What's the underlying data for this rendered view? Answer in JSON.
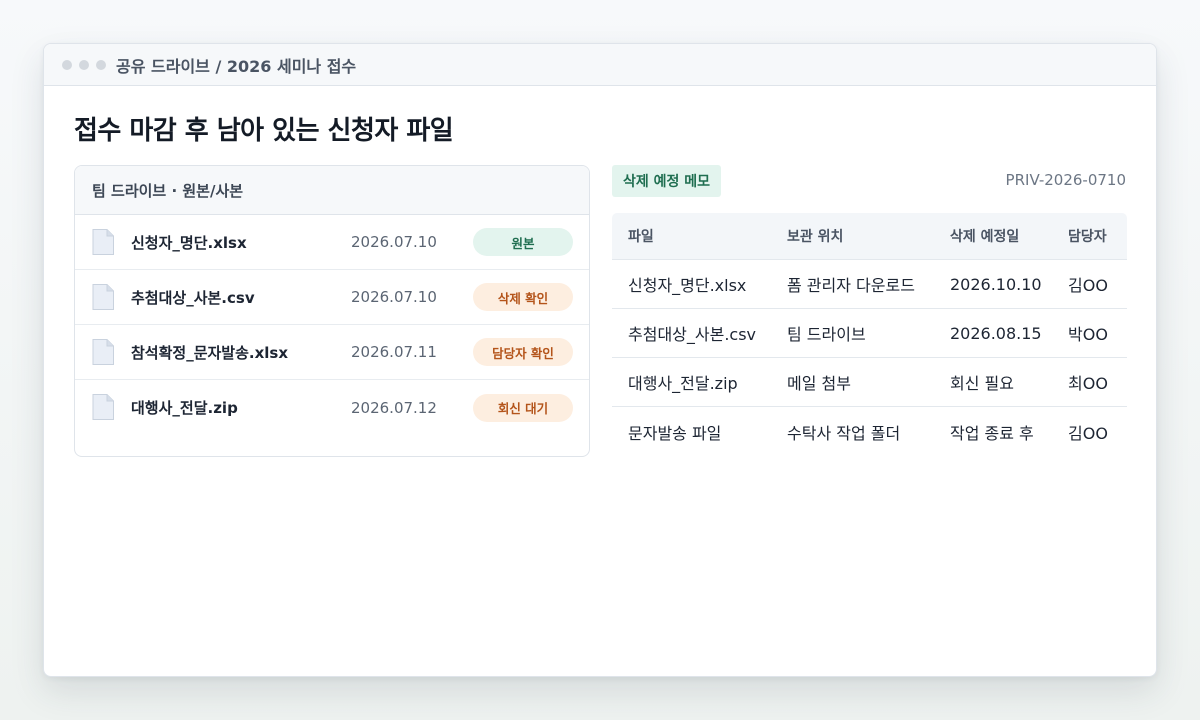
{
  "window": {
    "breadcrumb": "공유 드라이브 / 2026 세미나 접수"
  },
  "page": {
    "title": "접수 마감 후 남아 있는 신청자 파일"
  },
  "drive_panel": {
    "header": "팀 드라이브 · 원본/사본",
    "files": [
      {
        "name": "신청자_명단.xlsx",
        "date": "2026.07.10",
        "badge": "원본",
        "badge_tone": "green",
        "icon": "file-icon"
      },
      {
        "name": "추첨대상_사본.csv",
        "date": "2026.07.10",
        "badge": "삭제 확인",
        "badge_tone": "orange",
        "icon": "file-icon"
      },
      {
        "name": "참석확정_문자발송.xlsx",
        "date": "2026.07.11",
        "badge": "담당자 확인",
        "badge_tone": "orange",
        "icon": "file-icon"
      },
      {
        "name": "대행사_전달.zip",
        "date": "2026.07.12",
        "badge": "회신 대기",
        "badge_tone": "orange",
        "icon": "file-icon"
      }
    ]
  },
  "memo": {
    "tag": "삭제 예정 메모",
    "doc_id": "PRIV-2026-0710",
    "columns": [
      "파일",
      "보관 위치",
      "삭제 예정일",
      "담당자"
    ],
    "rows": [
      [
        "신청자_명단.xlsx",
        "폼 관리자 다운로드",
        "2026.10.10",
        "김OO"
      ],
      [
        "추첨대상_사본.csv",
        "팀 드라이브",
        "2026.08.15",
        "박OO"
      ],
      [
        "대행사_전달.zip",
        "메일 첨부",
        "회신 필요",
        "최OO"
      ],
      [
        "문자발송 파일",
        "수탁사 작업 폴더",
        "작업 종료 후",
        "김OO"
      ]
    ]
  },
  "colors": {
    "accent_green": "#1f6e50",
    "accent_green_bg": "#e3f4ee",
    "accent_orange": "#b4541a",
    "accent_orange_bg": "#fdeee0"
  }
}
